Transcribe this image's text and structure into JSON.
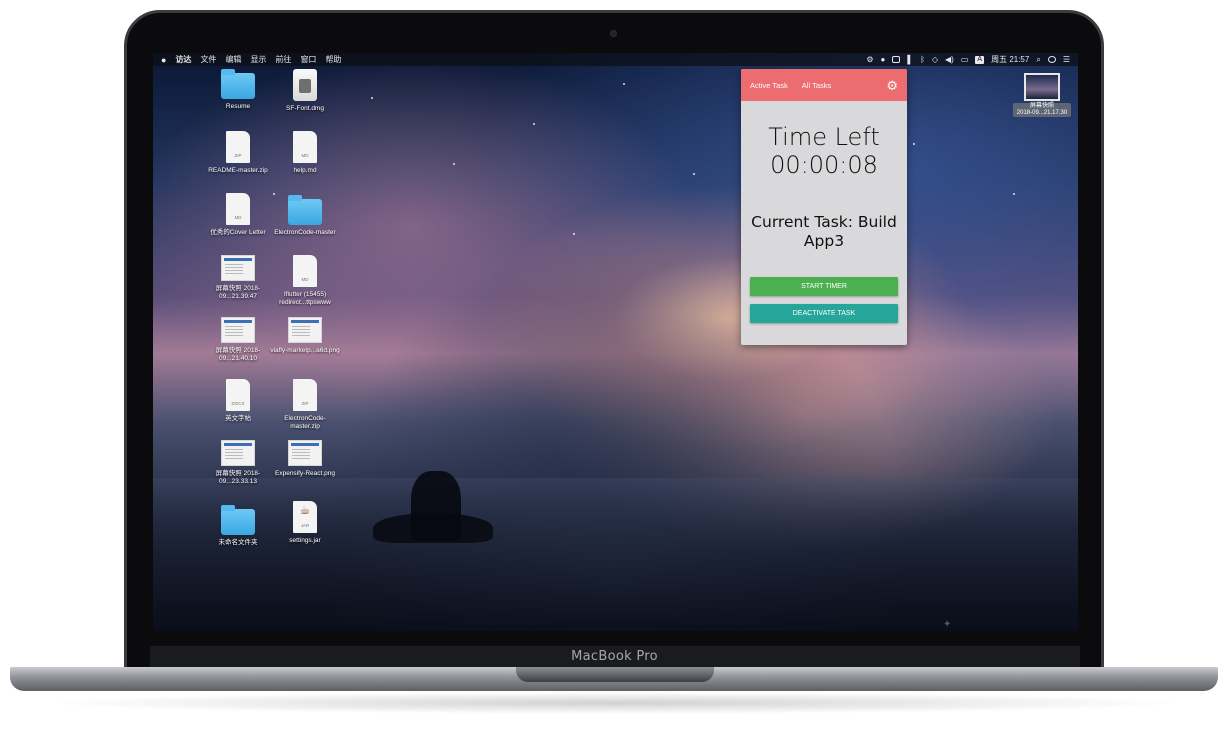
{
  "laptop": {
    "brand": "MacBook Pro"
  },
  "menubar": {
    "apple": "",
    "items": [
      "访达",
      "文件",
      "编辑",
      "显示",
      "前往",
      "窗口",
      "帮助"
    ],
    "input_badge": "A",
    "clock": "周五 21:57"
  },
  "desktop_icons": [
    {
      "label": "Resume",
      "kind": "folder"
    },
    {
      "label": "SF-Font.dmg",
      "kind": "dmg"
    },
    {
      "label": "README-master.zip",
      "kind": "doc",
      "ext": "ZIP"
    },
    {
      "label": "help.md",
      "kind": "doc",
      "ext": "MD"
    },
    {
      "label": "优秀的Cover Letter",
      "kind": "doc",
      "ext": "MD"
    },
    {
      "label": "ElectronCode-master",
      "kind": "folder"
    },
    {
      "label": "屏幕快照 2018-09...21.39.47",
      "kind": "thumb"
    },
    {
      "label": "Iflutter (15455) redirect...ttpswww",
      "kind": "doc",
      "ext": "MD"
    },
    {
      "label": "屏幕快照 2018-09...21.40.10",
      "kind": "thumb"
    },
    {
      "label": "viafly-marketp...a6d.png",
      "kind": "thumb"
    },
    {
      "label": "英文字帖",
      "kind": "doc",
      "ext": "DOCX"
    },
    {
      "label": "ElectronCode-master.zip",
      "kind": "doc",
      "ext": "ZIP"
    },
    {
      "label": "屏幕快照 2018-09...23.33.13",
      "kind": "thumb"
    },
    {
      "label": "Expensify-React.png",
      "kind": "thumb"
    },
    {
      "label": "未命名文件夹",
      "kind": "folder"
    },
    {
      "label": "settings.jar",
      "kind": "jar",
      "ext": "JAR"
    }
  ],
  "screenshot_icon": {
    "line1": "屏幕快照",
    "line2": "2018-09...21.17.30"
  },
  "popup": {
    "tabs": [
      "Active Task",
      "All Tasks"
    ],
    "gear_icon": "gear-icon",
    "time_title": "Time Left",
    "time_value": "00:00:08",
    "task_label": "Current Task: Build App3",
    "start_button": "START TIMER",
    "deactivate_button": "DEACTIVATE TASK",
    "colors": {
      "header": "#ec6c6f",
      "start": "#4caf50",
      "deactivate": "#26a69a",
      "panel": "#d9d9db"
    }
  }
}
